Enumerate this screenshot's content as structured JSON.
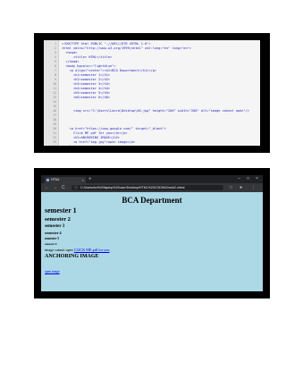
{
  "editor": {
    "lines": [
      {
        "num": "1",
        "code": "<!DOCTYPE html PUBLIC \"-//W3C//DTD XHTML 1.0\">"
      },
      {
        "num": "2",
        "code": "<html xmlns=\"http://www.w3.org/1999/xhtml\" xml:lang=\"en\" lang=\"en\">"
      },
      {
        "num": "3",
        "code": "  <head>"
      },
      {
        "num": "4",
        "code": "      <title> HTML</title>"
      },
      {
        "num": "5",
        "code": "  </head>"
      },
      {
        "num": "6",
        "code": "  <body bgcolor=\"lightblue\">"
      },
      {
        "num": "7",
        "code": "    <p align=\"center\"><h1>BCA Department</h1></p>"
      },
      {
        "num": "8",
        "code": "      <h1>semester 1</h1>"
      },
      {
        "num": "9",
        "code": "      <h2>semester 2</h2>"
      },
      {
        "num": "10",
        "code": "      <h3>semester 3</h3>"
      },
      {
        "num": "11",
        "code": "      <h4>semester 4</h4>"
      },
      {
        "num": "12",
        "code": "      <h5>semester 5</h5>"
      },
      {
        "num": "13",
        "code": "      <h6>semester 6</h6>"
      },
      {
        "num": "14",
        "code": ""
      },
      {
        "num": "15",
        "code": ""
      },
      {
        "num": "16",
        "code": "      <img src=\"C:\\Users\\Laura\\Desktop\\46.jpg\" height=\"200\" width=\"200\" alt=\"image cannot open\"/>"
      },
      {
        "num": "17",
        "code": ""
      },
      {
        "num": "18",
        "code": ""
      },
      {
        "num": "19",
        "code": ""
      },
      {
        "num": "20",
        "code": "    <a href=\"https://www.google.com/\" target=\"_blank\">"
      },
      {
        "num": "21",
        "code": "      Click ME pdf for you</a></p>"
      },
      {
        "num": "22",
        "code": "      <h2>ANCHORING IMAGE</h2>"
      },
      {
        "num": "23",
        "code": "      <a href=\"img.jpg\">open image</a>"
      },
      {
        "num": "24",
        "code": "  </body>"
      },
      {
        "num": "25",
        "code": "</html>"
      }
    ]
  },
  "browser": {
    "tab_title": "HTML",
    "tab_close": "×",
    "new_tab": "+",
    "win_min": "–",
    "win_max": "□",
    "win_close": "×",
    "back": "←",
    "forward": "→",
    "reload": "C",
    "address": "C:/Users/hcl%20laptop%20user/Desktop/HTML%20CODING/web2.xhtml",
    "page": {
      "title": "BCA Department",
      "h1": "semester 1",
      "h2": "semester 2",
      "h3": "semester 3",
      "h4": "semester 4",
      "h5": "semester 5",
      "h6": "semester 6",
      "alt_text": "image cannot open",
      "link_text": "CLICK ME pdf for you",
      "anchor_heading": "ANCHORING IMAGE",
      "open_image": "open image"
    }
  }
}
